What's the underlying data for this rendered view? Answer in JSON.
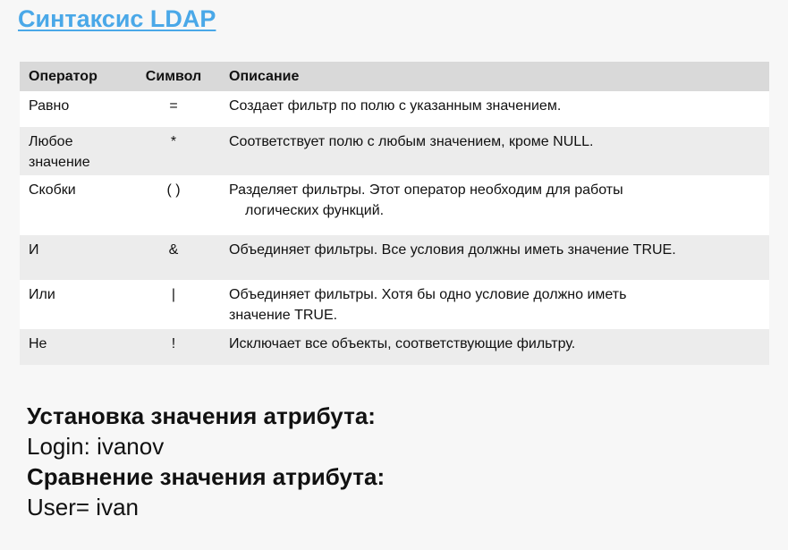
{
  "title": "Синтаксис LDAP",
  "table": {
    "headers": {
      "operator": "Оператор",
      "symbol": "Символ",
      "description": "Описание"
    },
    "rows": [
      {
        "operator": "Равно",
        "symbol": "=",
        "description": "Создает фильтр по полю с указанным значением.",
        "description_cont": ""
      },
      {
        "operator": "Любое значение",
        "symbol": "*",
        "description": "Соответствует полю с любым значением, кроме NULL.",
        "description_cont": ""
      },
      {
        "operator": "Скобки",
        "symbol": "( )",
        "description": "Разделяет фильтры. Этот оператор необходим для работы",
        "description_cont": "логических функций."
      },
      {
        "operator": "И",
        "symbol": "&",
        "description": "Объединяет фильтры. Все условия должны иметь значение TRUE.",
        "description_cont": ""
      },
      {
        "operator": "Или",
        "symbol": "|",
        "description": "Объединяет фильтры. Хотя бы одно условие должно иметь",
        "description_cont": "значение TRUE."
      },
      {
        "operator": "Не",
        "symbol": "!",
        "description": "Исключает все объекты, соответствующие фильтру.",
        "description_cont": ""
      }
    ]
  },
  "notes": {
    "set_heading": "Установка значения атрибута:",
    "set_example": "Login: ivanov",
    "compare_heading": "Сравнение значения атрибута:",
    "compare_example": "User= ivan"
  }
}
